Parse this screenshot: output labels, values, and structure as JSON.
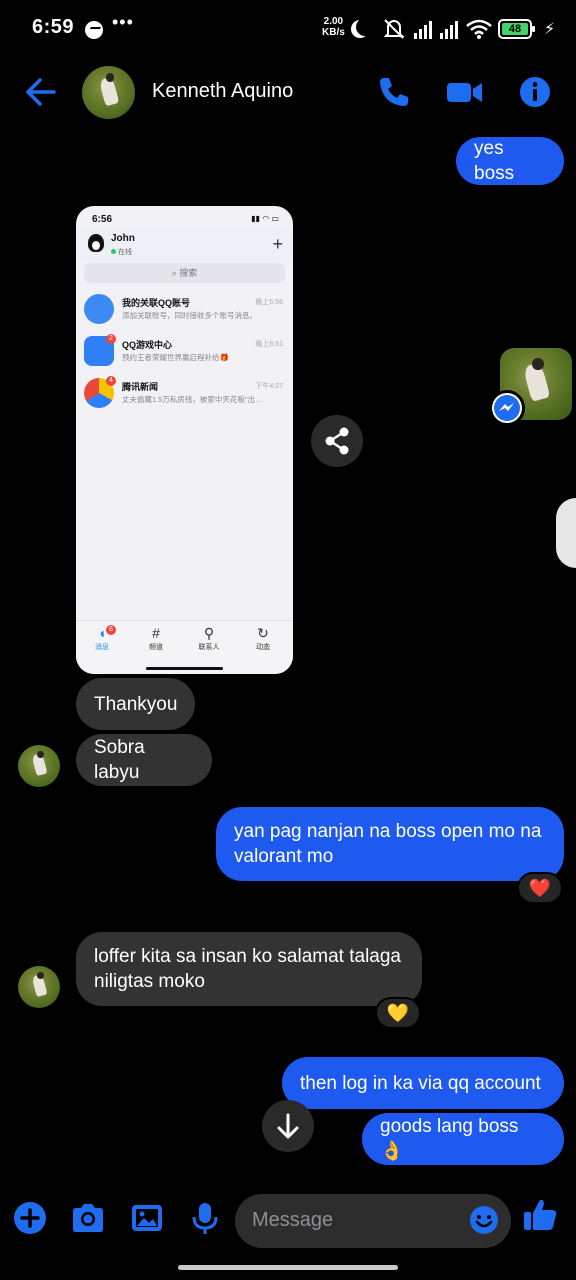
{
  "status_bar": {
    "time": "6:59",
    "dots": "•••",
    "speed_value": "2.00",
    "speed_unit": "KB/s",
    "battery": "48"
  },
  "header": {
    "contact_name": "Kenneth Aquino"
  },
  "messages": {
    "m1": "yes boss",
    "m2": "Thankyou",
    "m3": "Sobra labyu",
    "m4": "yan pag nanjan na boss open mo na valorant mo",
    "m4_reaction": "❤️",
    "m5": "loffer kita sa insan ko salamat talaga niligtas moko",
    "m5_reaction": "💛",
    "m6": "then log in ka via qq account",
    "m7": "goods lang boss 👌"
  },
  "shared_screenshot": {
    "time": "6:56",
    "user": "John",
    "online": "在线",
    "search": "搜索",
    "rows": [
      {
        "title": "我的关联QQ账号",
        "subtitle": "添加关联账号，同时接收多个账号消息。",
        "time": "晚上6:56",
        "badge": ""
      },
      {
        "title": "QQ游戏中心",
        "subtitle": "预约王者荣耀世界赢启程补给🎁",
        "time": "晚上6:51",
        "badge": "2"
      },
      {
        "title": "腾讯新闻",
        "subtitle": "丈夫偷藏1.5万私房钱，被家中天花板\"出…",
        "time": "下午4:27",
        "badge": "4"
      }
    ],
    "tabs": [
      {
        "label": "消息",
        "badge": "8"
      },
      {
        "label": "频道"
      },
      {
        "label": "联系人"
      },
      {
        "label": "动态"
      }
    ]
  },
  "composer": {
    "placeholder": "Message"
  },
  "colors": {
    "accent": "#1e5af0",
    "incoming": "#333333",
    "background": "#000000"
  }
}
